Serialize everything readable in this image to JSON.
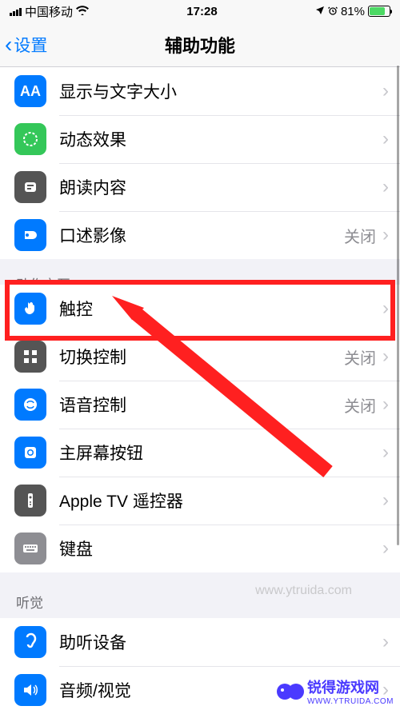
{
  "statusBar": {
    "carrier": "中国移动",
    "time": "17:28",
    "battery": "81%"
  },
  "nav": {
    "back": "设置",
    "title": "辅助功能"
  },
  "valueOff": "关闭",
  "groups": {
    "visionTail": [
      {
        "icon": "aa",
        "iconClass": "icon-blue",
        "label": "显示与文字大小"
      },
      {
        "icon": "motion",
        "iconClass": "icon-green",
        "label": "动态效果"
      },
      {
        "icon": "speech",
        "iconClass": "icon-gray-dark",
        "label": "朗读内容"
      },
      {
        "icon": "audio-desc",
        "iconClass": "icon-blue",
        "label": "口述影像",
        "value": "关闭"
      }
    ],
    "interactionHeader": "动作交互",
    "interaction": [
      {
        "icon": "touch",
        "iconClass": "icon-blue",
        "label": "触控",
        "highlight": true
      },
      {
        "icon": "switch",
        "iconClass": "icon-gray-dark",
        "label": "切换控制",
        "value": "关闭"
      },
      {
        "icon": "voice",
        "iconClass": "icon-blue",
        "label": "语音控制",
        "value": "关闭"
      },
      {
        "icon": "home",
        "iconClass": "icon-blue",
        "label": "主屏幕按钮"
      },
      {
        "icon": "remote",
        "iconClass": "icon-gray-dark",
        "label": "Apple TV 遥控器"
      },
      {
        "icon": "keyboard",
        "iconClass": "icon-gray",
        "label": "键盘"
      }
    ],
    "hearingHeader": "听觉",
    "hearing": [
      {
        "icon": "ear",
        "iconClass": "icon-blue",
        "label": "助听设备"
      },
      {
        "icon": "av",
        "iconClass": "icon-blue",
        "label": "音频/视觉"
      }
    ]
  },
  "watermark": "www.ytruida.com",
  "footer": {
    "brand": "锐得游戏网",
    "url": "WWW.YTRUIDA.COM"
  }
}
